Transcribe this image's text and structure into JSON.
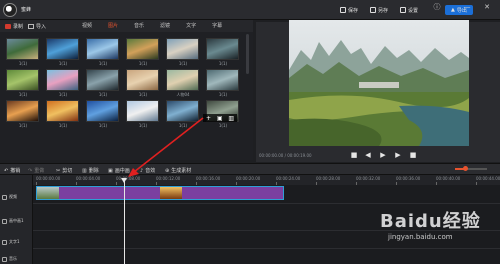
{
  "header": {
    "app_title": "蜜蜂",
    "buttons": [
      "保存",
      "另存",
      "设置"
    ],
    "export_label": "导出",
    "window_controls": [
      "ⓘ",
      "—",
      "✕"
    ]
  },
  "library": {
    "media_buttons": [
      "录制",
      "导入"
    ],
    "tabs": [
      "视频",
      "图片",
      "音乐",
      "滤镜",
      "文字",
      "字幕"
    ],
    "active_tab": "图片",
    "thumbnails": [
      {
        "label": "1(1)",
        "colors": [
          "#6b8a9c",
          "#3f6b3a",
          "#c7b07d"
        ]
      },
      {
        "label": "1(1)",
        "colors": [
          "#1b3a6a",
          "#4fa0d8",
          "#0d1f3a"
        ]
      },
      {
        "label": "1(1)",
        "colors": [
          "#3a6ea8",
          "#9cc8e8",
          "#1c3660"
        ]
      },
      {
        "label": "1(1)",
        "colors": [
          "#5a7a3c",
          "#d2a05a",
          "#2c3b20"
        ]
      },
      {
        "label": "1(1)",
        "colors": [
          "#7fa0b8",
          "#d9d1c2",
          "#556b7d"
        ]
      },
      {
        "label": "1(1)",
        "colors": [
          "#2c3a40",
          "#6a8a90",
          "#1a2226"
        ]
      },
      {
        "label": "1(1)",
        "colors": [
          "#5e8a3a",
          "#a5c46a",
          "#394f22"
        ]
      },
      {
        "label": "1(1)",
        "colors": [
          "#7ac0e0",
          "#e8a0c0",
          "#3a6080"
        ]
      },
      {
        "label": "1(1)",
        "colors": [
          "#33434b",
          "#8aa2ab",
          "#1d262b"
        ]
      },
      {
        "label": "1(1)",
        "colors": [
          "#c9a57e",
          "#e8d2b0",
          "#8a6642"
        ]
      },
      {
        "label": "人物04",
        "colors": [
          "#9ab8a0",
          "#e0d0b0",
          "#4e6a52"
        ]
      },
      {
        "label": "1(1)",
        "colors": [
          "#4e6a72",
          "#a0b8bc",
          "#2a3a3e"
        ]
      },
      {
        "label": "1(1)",
        "colors": [
          "#6a3a20",
          "#e8a050",
          "#201008"
        ]
      },
      {
        "label": "1(1)",
        "colors": [
          "#d07020",
          "#f0c060",
          "#803010"
        ]
      },
      {
        "label": "1(1)",
        "colors": [
          "#2050a0",
          "#60a0e0",
          "#0a2040"
        ]
      },
      {
        "label": "1(1)",
        "colors": [
          "#b0c8e0",
          "#f0f0f0",
          "#607890"
        ]
      },
      {
        "label": "1(1)",
        "colors": [
          "#2c4a6a",
          "#80b0d0",
          "#102030"
        ]
      },
      {
        "label": "1(1)",
        "colors": [
          "#404a40",
          "#90a090",
          "#202620"
        ]
      }
    ]
  },
  "preview": {
    "timecode": "00:00:00.00 / 00:00:19.00",
    "controls": [
      "■",
      "◀",
      "▶",
      "▶",
      "■"
    ]
  },
  "editbar": {
    "buttons": [
      "撤销",
      "重做",
      "剪切",
      "删除",
      "画中画",
      "音效",
      "生成素材"
    ]
  },
  "timeline": {
    "ticks": [
      "00:00:00.00",
      "00:00:04.00",
      "00:00:08.00",
      "00:00:12.00",
      "00:00:16.00",
      "00:00:20.00",
      "00:00:24.00",
      "00:00:28.00",
      "00:00:32.00",
      "00:00:36.00",
      "00:00:40.00",
      "00:00:44.00"
    ],
    "tracks": [
      "视频",
      "画中画1",
      "文字1",
      "音乐"
    ]
  },
  "watermark": {
    "logo": "Baidu经验",
    "url": "jingyan.baidu.com"
  }
}
